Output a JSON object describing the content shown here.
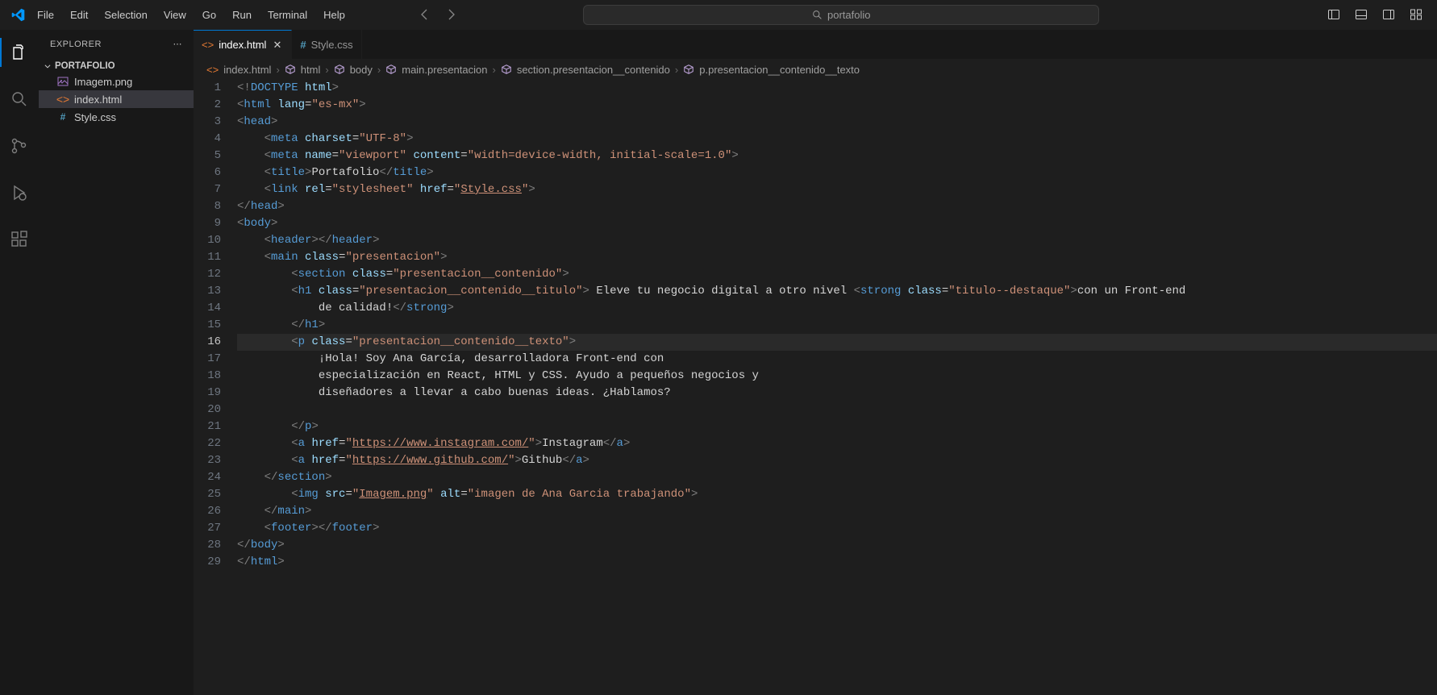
{
  "titlebar": {
    "menu": [
      "File",
      "Edit",
      "Selection",
      "View",
      "Go",
      "Run",
      "Terminal",
      "Help"
    ],
    "search_placeholder": "portafolio"
  },
  "sidebar": {
    "title": "EXPLORER",
    "folder": "PORTAFOLIO",
    "files": [
      {
        "name": "Imagem.png",
        "icon": "image",
        "color": "#a074c4"
      },
      {
        "name": "index.html",
        "icon": "html",
        "color": "#e37933"
      },
      {
        "name": "Style.css",
        "icon": "css",
        "color": "#519aba"
      }
    ]
  },
  "tabs": [
    {
      "name": "index.html",
      "icon_color": "#e37933",
      "active": true
    },
    {
      "name": "Style.css",
      "icon_color": "#519aba",
      "active": false
    }
  ],
  "breadcrumbs": [
    "index.html",
    "html",
    "body",
    "main.presentacion",
    "section.presentacion__contenido",
    "p.presentacion__contenido__texto"
  ],
  "code": {
    "lines": [
      {
        "n": 1,
        "html": "<span class='t-gray'>&lt;!</span><span class='t-blue'>DOCTYPE</span> <span class='t-lightblue'>html</span><span class='t-gray'>&gt;</span>"
      },
      {
        "n": 2,
        "html": "<span class='t-gray'>&lt;</span><span class='t-blue'>html</span> <span class='t-lightblue'>lang</span>=<span class='t-string'>\"es-mx\"</span><span class='t-gray'>&gt;</span>"
      },
      {
        "n": 3,
        "html": "<span class='t-gray'>&lt;</span><span class='t-blue'>head</span><span class='t-gray'>&gt;</span>"
      },
      {
        "n": 4,
        "html": "    <span class='t-gray'>&lt;</span><span class='t-blue'>meta</span> <span class='t-lightblue'>charset</span>=<span class='t-string'>\"UTF-8\"</span><span class='t-gray'>&gt;</span>"
      },
      {
        "n": 5,
        "html": "    <span class='t-gray'>&lt;</span><span class='t-blue'>meta</span> <span class='t-lightblue'>name</span>=<span class='t-string'>\"viewport\"</span> <span class='t-lightblue'>content</span>=<span class='t-string'>\"width=device-width, initial-scale=1.0\"</span><span class='t-gray'>&gt;</span>"
      },
      {
        "n": 6,
        "html": "    <span class='t-gray'>&lt;</span><span class='t-blue'>title</span><span class='t-gray'>&gt;</span>Portafolio<span class='t-gray'>&lt;/</span><span class='t-blue'>title</span><span class='t-gray'>&gt;</span>"
      },
      {
        "n": 7,
        "html": "    <span class='t-gray'>&lt;</span><span class='t-blue'>link</span> <span class='t-lightblue'>rel</span>=<span class='t-string'>\"stylesheet\"</span> <span class='t-lightblue'>href</span>=<span class='t-string'>\"<span class='t-underline'>Style.css</span>\"</span><span class='t-gray'>&gt;</span>"
      },
      {
        "n": 8,
        "html": "<span class='t-gray'>&lt;/</span><span class='t-blue'>head</span><span class='t-gray'>&gt;</span>"
      },
      {
        "n": 9,
        "html": "<span class='t-gray'>&lt;</span><span class='t-blue'>body</span><span class='t-gray'>&gt;</span>"
      },
      {
        "n": 10,
        "html": "    <span class='t-gray'>&lt;</span><span class='t-blue'>header</span><span class='t-gray'>&gt;&lt;/</span><span class='t-blue'>header</span><span class='t-gray'>&gt;</span>"
      },
      {
        "n": 11,
        "html": "    <span class='t-gray'>&lt;</span><span class='t-blue'>main</span> <span class='t-lightblue'>class</span>=<span class='t-string'>\"presentacion\"</span><span class='t-gray'>&gt;</span>"
      },
      {
        "n": 12,
        "html": "        <span class='t-gray'>&lt;</span><span class='t-blue'>section</span> <span class='t-lightblue'>class</span>=<span class='t-string'>\"presentacion__contenido\"</span><span class='t-gray'>&gt;</span>"
      },
      {
        "n": 13,
        "html": "        <span class='t-gray'>&lt;</span><span class='t-blue'>h1</span> <span class='t-lightblue'>class</span>=<span class='t-string'>\"presentacion__contenido__titulo\"</span><span class='t-gray'>&gt;</span> Eleve tu negocio digital a otro nivel <span class='t-gray'>&lt;</span><span class='t-blue'>strong</span> <span class='t-lightblue'>class</span>=<span class='t-string'>\"titulo--destaque\"</span><span class='t-gray'>&gt;</span>con un Front-end"
      },
      {
        "n": 14,
        "html": "            de calidad!<span class='t-gray'>&lt;/</span><span class='t-blue'>strong</span><span class='t-gray'>&gt;</span>"
      },
      {
        "n": 15,
        "html": "        <span class='t-gray'>&lt;/</span><span class='t-blue'>h1</span><span class='t-gray'>&gt;</span>"
      },
      {
        "n": 16,
        "current": true,
        "html": "        <span class='t-gray'>&lt;</span><span class='t-blue'>p</span> <span class='t-lightblue'>class</span>=<span class='t-string'>\"presentacion__contenido__texto\"</span><span class='t-gray'>&gt;</span>"
      },
      {
        "n": 17,
        "html": "            ¡Hola! Soy Ana García, desarrolladora Front-end con"
      },
      {
        "n": 18,
        "html": "            especialización en React, HTML y CSS. Ayudo a pequeños negocios y"
      },
      {
        "n": 19,
        "html": "            diseñadores a llevar a cabo buenas ideas. ¿Hablamos?"
      },
      {
        "n": 20,
        "html": ""
      },
      {
        "n": 21,
        "html": "        <span class='t-gray'>&lt;/</span><span class='t-blue'>p</span><span class='t-gray'>&gt;</span>"
      },
      {
        "n": 22,
        "html": "        <span class='t-gray'>&lt;</span><span class='t-blue'>a</span> <span class='t-lightblue'>href</span>=<span class='t-string'>\"<span class='t-underline'>https://www.instagram.com/</span>\"</span><span class='t-gray'>&gt;</span>Instagram<span class='t-gray'>&lt;/</span><span class='t-blue'>a</span><span class='t-gray'>&gt;</span>"
      },
      {
        "n": 23,
        "html": "        <span class='t-gray'>&lt;</span><span class='t-blue'>a</span> <span class='t-lightblue'>href</span>=<span class='t-string'>\"<span class='t-underline'>https://www.github.com/</span>\"</span><span class='t-gray'>&gt;</span>Github<span class='t-gray'>&lt;/</span><span class='t-blue'>a</span><span class='t-gray'>&gt;</span>"
      },
      {
        "n": 24,
        "html": "    <span class='t-gray'>&lt;/</span><span class='t-blue'>section</span><span class='t-gray'>&gt;</span>"
      },
      {
        "n": 25,
        "html": "        <span class='t-gray'>&lt;</span><span class='t-blue'>img</span> <span class='t-lightblue'>src</span>=<span class='t-string'>\"<span class='t-underline'>Imagem.png</span>\"</span> <span class='t-lightblue'>alt</span>=<span class='t-string'>\"imagen de Ana Garcia trabajando\"</span><span class='t-gray'>&gt;</span>"
      },
      {
        "n": 26,
        "html": "    <span class='t-gray'>&lt;/</span><span class='t-blue'>main</span><span class='t-gray'>&gt;</span>"
      },
      {
        "n": 27,
        "html": "    <span class='t-gray'>&lt;</span><span class='t-blue'>footer</span><span class='t-gray'>&gt;&lt;/</span><span class='t-blue'>footer</span><span class='t-gray'>&gt;</span>"
      },
      {
        "n": 28,
        "html": "<span class='t-gray'>&lt;/</span><span class='t-blue'>body</span><span class='t-gray'>&gt;</span>"
      },
      {
        "n": 29,
        "html": "<span class='t-gray'>&lt;/</span><span class='t-blue'>html</span><span class='t-gray'>&gt;</span>"
      }
    ]
  }
}
